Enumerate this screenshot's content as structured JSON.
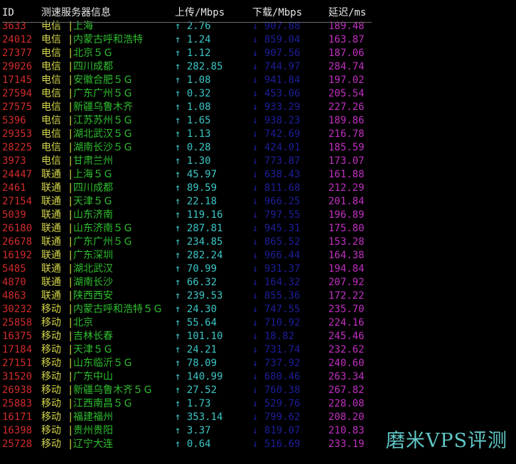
{
  "header": {
    "id": "ID",
    "server": "测速服务器信息",
    "upload": "上传/Mbps",
    "download": "下载/Mbps",
    "latency": "延迟/ms"
  },
  "separator": "|",
  "rows": [
    {
      "id": "3633",
      "isp": "电信",
      "city": "上海",
      "up": "↑ 2.76",
      "down": "↓ 907.88",
      "lat": "189.48"
    },
    {
      "id": "24012",
      "isp": "电信",
      "city": "内蒙古呼和浩特",
      "up": "↑ 1.24",
      "down": "↓ 859.04",
      "lat": "163.87"
    },
    {
      "id": "27377",
      "isp": "电信",
      "city": "北京５Ｇ",
      "up": "↑ 1.12",
      "down": "↓ 907.56",
      "lat": "187.06"
    },
    {
      "id": "29026",
      "isp": "电信",
      "city": "四川成都",
      "up": "↑ 282.85",
      "down": "↓ 744.97",
      "lat": "284.74"
    },
    {
      "id": "17145",
      "isp": "电信",
      "city": "安徽合肥５Ｇ",
      "up": "↑ 1.08",
      "down": "↓ 941.84",
      "lat": "197.02"
    },
    {
      "id": "27594",
      "isp": "电信",
      "city": "广东广州５Ｇ",
      "up": "↑ 0.32",
      "down": "↓ 453.06",
      "lat": "205.54"
    },
    {
      "id": "27575",
      "isp": "电信",
      "city": "新疆乌鲁木齐",
      "up": "↑ 1.08",
      "down": "↓ 933.29",
      "lat": "227.26"
    },
    {
      "id": "5396",
      "isp": "电信",
      "city": "江苏苏州５Ｇ",
      "up": "↑ 1.65",
      "down": "↓ 938.23",
      "lat": "189.86"
    },
    {
      "id": "29353",
      "isp": "电信",
      "city": "湖北武汉５Ｇ",
      "up": "↑ 1.13",
      "down": "↓ 742.69",
      "lat": "216.78"
    },
    {
      "id": "28225",
      "isp": "电信",
      "city": "湖南长沙５Ｇ",
      "up": "↑ 0.28",
      "down": "↓ 424.01",
      "lat": "185.59"
    },
    {
      "id": "3973",
      "isp": "电信",
      "city": "甘肃兰州",
      "up": "↑ 1.30",
      "down": "↓ 773.87",
      "lat": "173.07"
    },
    {
      "id": "24447",
      "isp": "联通",
      "city": "上海５Ｇ",
      "up": "↑ 45.97",
      "down": "↓ 638.43",
      "lat": "161.88"
    },
    {
      "id": "2461",
      "isp": "联通",
      "city": "四川成都",
      "up": "↑ 89.59",
      "down": "↓ 811.68",
      "lat": "212.29"
    },
    {
      "id": "27154",
      "isp": "联通",
      "city": "天津５Ｇ",
      "up": "↑ 22.18",
      "down": "↓ 966.25",
      "lat": "201.84"
    },
    {
      "id": "5039",
      "isp": "联通",
      "city": "山东济南",
      "up": "↑ 119.16",
      "down": "↓ 797.55",
      "lat": "196.89"
    },
    {
      "id": "26180",
      "isp": "联通",
      "city": "山东济南５Ｇ",
      "up": "↑ 287.81",
      "down": "↓ 945.31",
      "lat": "175.80"
    },
    {
      "id": "26678",
      "isp": "联通",
      "city": "广东广州５Ｇ",
      "up": "↑ 234.85",
      "down": "↓ 865.52",
      "lat": "153.28"
    },
    {
      "id": "16192",
      "isp": "联通",
      "city": "广东深圳",
      "up": "↑ 282.24",
      "down": "↓ 966.44",
      "lat": "164.38"
    },
    {
      "id": "5485",
      "isp": "联通",
      "city": "湖北武汉",
      "up": "↑ 70.99",
      "down": "↓ 931.37",
      "lat": "194.84"
    },
    {
      "id": "4870",
      "isp": "联通",
      "city": "湖南长沙",
      "up": "↑ 66.32",
      "down": "↓ 164.32",
      "lat": "207.92"
    },
    {
      "id": "4863",
      "isp": "联通",
      "city": "陕西西安",
      "up": "↑ 239.53",
      "down": "↓ 855.36",
      "lat": "172.22"
    },
    {
      "id": "30232",
      "isp": "移动",
      "city": "内蒙古呼和浩特５Ｇ",
      "up": "↑ 24.30",
      "down": "↓ 747.55",
      "lat": "235.70"
    },
    {
      "id": "25858",
      "isp": "移动",
      "city": "北京",
      "up": "↑ 55.64",
      "down": "↓ 710.92",
      "lat": "224.16"
    },
    {
      "id": "16375",
      "isp": "移动",
      "city": "吉林长春",
      "up": "↑ 101.10",
      "down": "↓ 18.82",
      "lat": "245.46"
    },
    {
      "id": "17184",
      "isp": "移动",
      "city": "天津５Ｇ",
      "up": "↑ 24.21",
      "down": "↓ 731.74",
      "lat": "232.62"
    },
    {
      "id": "27151",
      "isp": "移动",
      "city": "山东临沂５Ｇ",
      "up": "↑ 78.09",
      "down": "↓ 737.92",
      "lat": "240.60"
    },
    {
      "id": "31520",
      "isp": "移动",
      "city": "广东中山",
      "up": "↑ 140.99",
      "down": "↓ 680.46",
      "lat": "263.34"
    },
    {
      "id": "26938",
      "isp": "移动",
      "city": "新疆乌鲁木齐５Ｇ",
      "up": "↑ 27.52",
      "down": "↓ 760.38",
      "lat": "267.82"
    },
    {
      "id": "25883",
      "isp": "移动",
      "city": "江西南昌５Ｇ",
      "up": "↑ 1.73",
      "down": "↓ 529.76",
      "lat": "228.08"
    },
    {
      "id": "16171",
      "isp": "移动",
      "city": "福建福州",
      "up": "↑ 353.14",
      "down": "↓ 799.62",
      "lat": "208.20"
    },
    {
      "id": "16398",
      "isp": "移动",
      "city": "贵州贵阳",
      "up": "↑ 3.37",
      "down": "↓ 819.07",
      "lat": "210.83"
    },
    {
      "id": "25728",
      "isp": "移动",
      "city": "辽宁大连",
      "up": "↑ 0.64",
      "down": "↓ 516.69",
      "lat": "233.19"
    }
  ],
  "watermark": "磨米VPS评测",
  "colors": {
    "background": "#000000",
    "id": "#d22b2b",
    "isp": "#d4d64a",
    "city": "#2fbf2f",
    "upload": "#3cc6c6",
    "download": "#1d1f9a",
    "latency": "#c12fc1",
    "watermark": "#5fc7c7"
  }
}
